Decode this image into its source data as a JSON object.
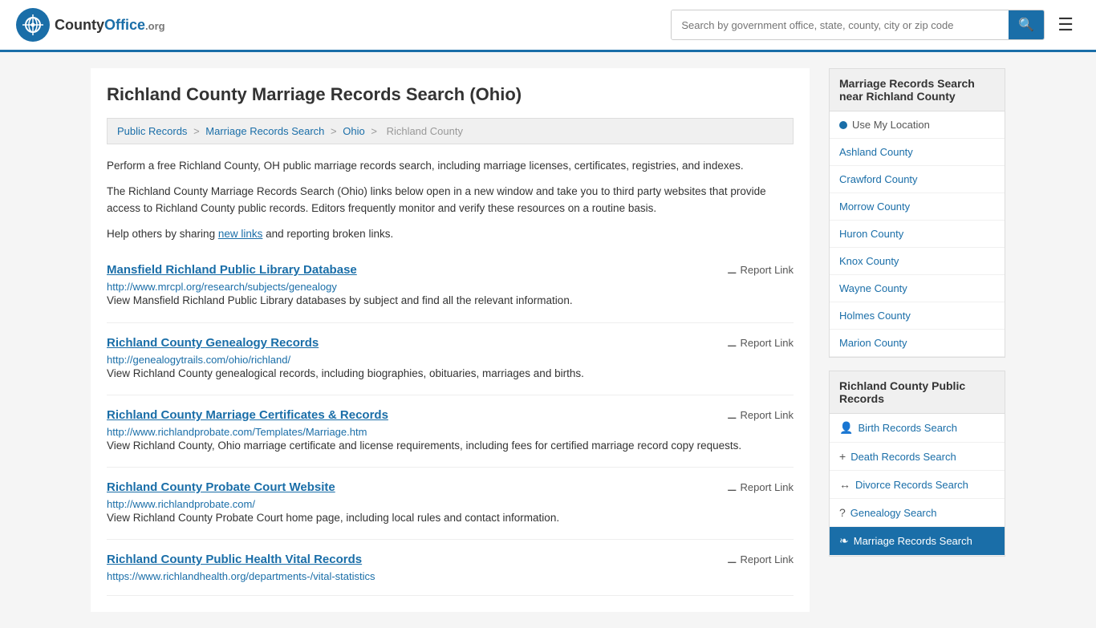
{
  "header": {
    "logo_text": "County",
    "logo_org": "Office",
    "logo_domain": ".org",
    "search_placeholder": "Search by government office, state, county, city or zip code",
    "menu_icon": "☰",
    "search_icon": "🔍"
  },
  "page": {
    "title": "Richland County Marriage Records Search (Ohio)",
    "breadcrumb": {
      "items": [
        "Public Records",
        "Marriage Records Search",
        "Ohio",
        "Richland County"
      ]
    },
    "description1": "Perform a free Richland County, OH public marriage records search, including marriage licenses, certificates, registries, and indexes.",
    "description2": "The Richland County Marriage Records Search (Ohio) links below open in a new window and take you to third party websites that provide access to Richland County public records. Editors frequently monitor and verify these resources on a routine basis.",
    "description3_before": "Help others by sharing ",
    "description3_link": "new links",
    "description3_after": " and reporting broken links."
  },
  "results": [
    {
      "title": "Mansfield Richland Public Library Database",
      "url": "http://www.mrcpl.org/research/subjects/genealogy",
      "description": "View Mansfield Richland Public Library databases by subject and find all the relevant information.",
      "report_label": "Report Link"
    },
    {
      "title": "Richland County Genealogy Records",
      "url": "http://genealogytrails.com/ohio/richland/",
      "description": "View Richland County genealogical records, including biographies, obituaries, marriages and births.",
      "report_label": "Report Link"
    },
    {
      "title": "Richland County Marriage Certificates & Records",
      "url": "http://www.richlandprobate.com/Templates/Marriage.htm",
      "description": "View Richland County, Ohio marriage certificate and license requirements, including fees for certified marriage record copy requests.",
      "report_label": "Report Link"
    },
    {
      "title": "Richland County Probate Court Website",
      "url": "http://www.richlandprobate.com/",
      "description": "View Richland County Probate Court home page, including local rules and contact information.",
      "report_label": "Report Link"
    },
    {
      "title": "Richland County Public Health Vital Records",
      "url": "https://www.richlandhealth.org/departments-/vital-statistics",
      "description": "",
      "report_label": "Report Link"
    }
  ],
  "sidebar": {
    "nearby_header": "Marriage Records Search near Richland County",
    "use_location_label": "Use My Location",
    "nearby_counties": [
      "Ashland County",
      "Crawford County",
      "Morrow County",
      "Huron County",
      "Knox County",
      "Wayne County",
      "Holmes County",
      "Marion County"
    ],
    "public_records_header": "Richland County Public Records",
    "public_records": [
      {
        "label": "Birth Records Search",
        "icon": "👤",
        "active": false
      },
      {
        "label": "Death Records Search",
        "icon": "✚",
        "active": false
      },
      {
        "label": "Divorce Records Search",
        "icon": "↔",
        "active": false
      },
      {
        "label": "Genealogy Search",
        "icon": "?",
        "active": false
      },
      {
        "label": "Marriage Records Search",
        "icon": "❧",
        "active": true
      }
    ]
  }
}
